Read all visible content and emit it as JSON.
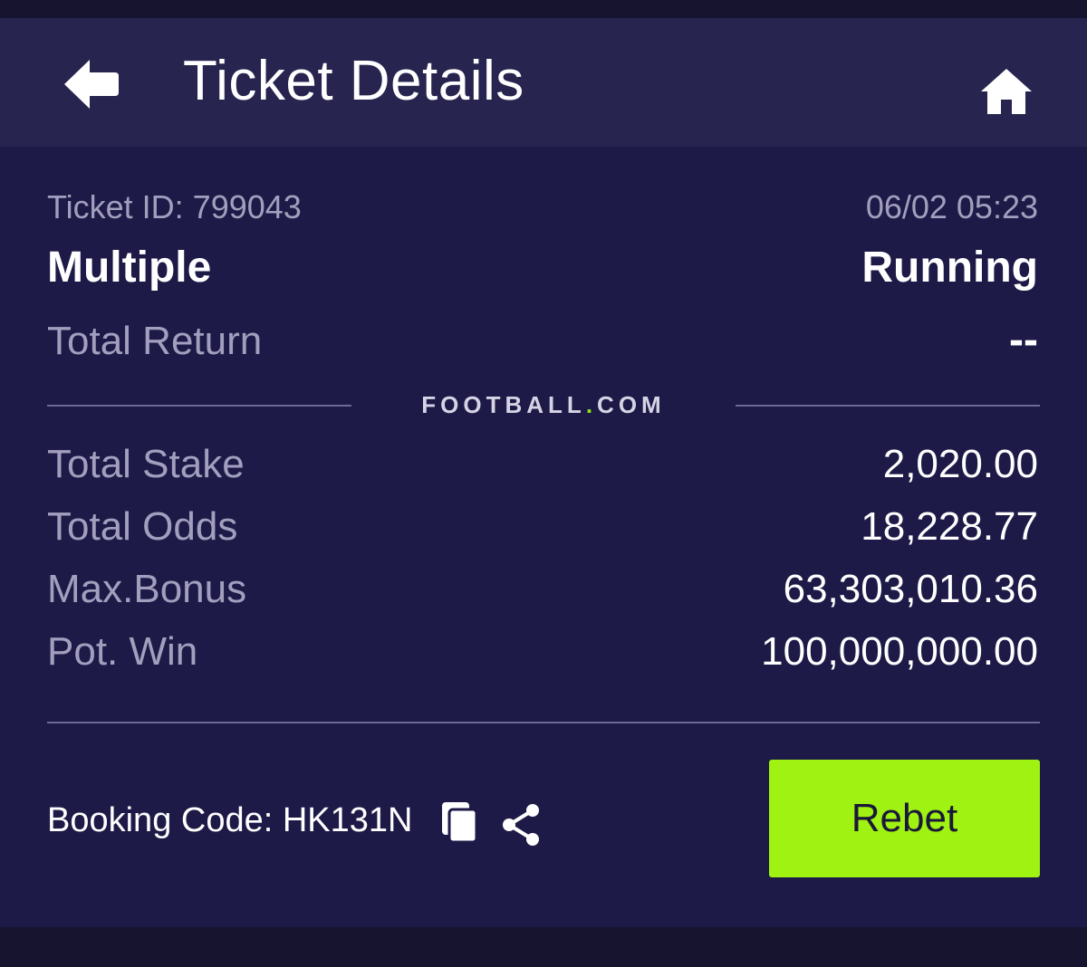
{
  "header": {
    "title": "Ticket Details",
    "back_icon": "back-arrow-icon",
    "home_icon": "home-icon"
  },
  "ticket": {
    "id_label": "Ticket ID: 799043",
    "datetime": "06/02 05:23",
    "type": "Multiple",
    "status": "Running",
    "total_return_label": "Total Return",
    "total_return_value": "--"
  },
  "brand": {
    "name_left": "FOOTBALL",
    "dot": ".",
    "name_right": "COM",
    "dot_color": "#8fe81a"
  },
  "summary": [
    {
      "label": "Total Stake",
      "value": "2,020.00"
    },
    {
      "label": "Total Odds",
      "value": "18,228.77"
    },
    {
      "label": "Max.Bonus",
      "value": "63,303,010.36"
    },
    {
      "label": "Pot. Win",
      "value": "100,000,000.00"
    }
  ],
  "booking": {
    "label": "Booking Code: HK131N",
    "copy_icon": "copy-icon",
    "share_icon": "share-icon"
  },
  "actions": {
    "rebet_label": "Rebet",
    "rebet_color": "#9ff212"
  },
  "colors": {
    "background": "#1e1a48",
    "header": "#27244f",
    "muted_text": "#a29fbe"
  }
}
